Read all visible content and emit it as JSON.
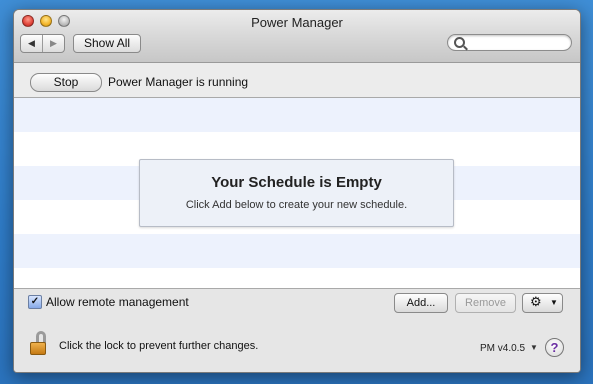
{
  "window": {
    "title": "Power Manager"
  },
  "toolbar": {
    "show_all_label": "Show All",
    "search_placeholder": "",
    "back_icon": "◀",
    "forward_icon": "▶"
  },
  "status": {
    "stop_label": "Stop",
    "running_text": "Power Manager is running"
  },
  "schedule": {
    "empty_title": "Your Schedule is Empty",
    "empty_subtitle": "Click Add below to create your new schedule."
  },
  "footer": {
    "remote_label": "Allow remote management",
    "remote_checked": true,
    "add_label": "Add...",
    "remove_label": "Remove",
    "lock_text": "Click the lock to prevent further changes.",
    "version_label": "PM v4.0.5",
    "help_label": "?"
  },
  "colors": {
    "desktop": "#2f7cc8",
    "row_alt": "#edf2fd",
    "help_accent": "#6b2fa3"
  }
}
